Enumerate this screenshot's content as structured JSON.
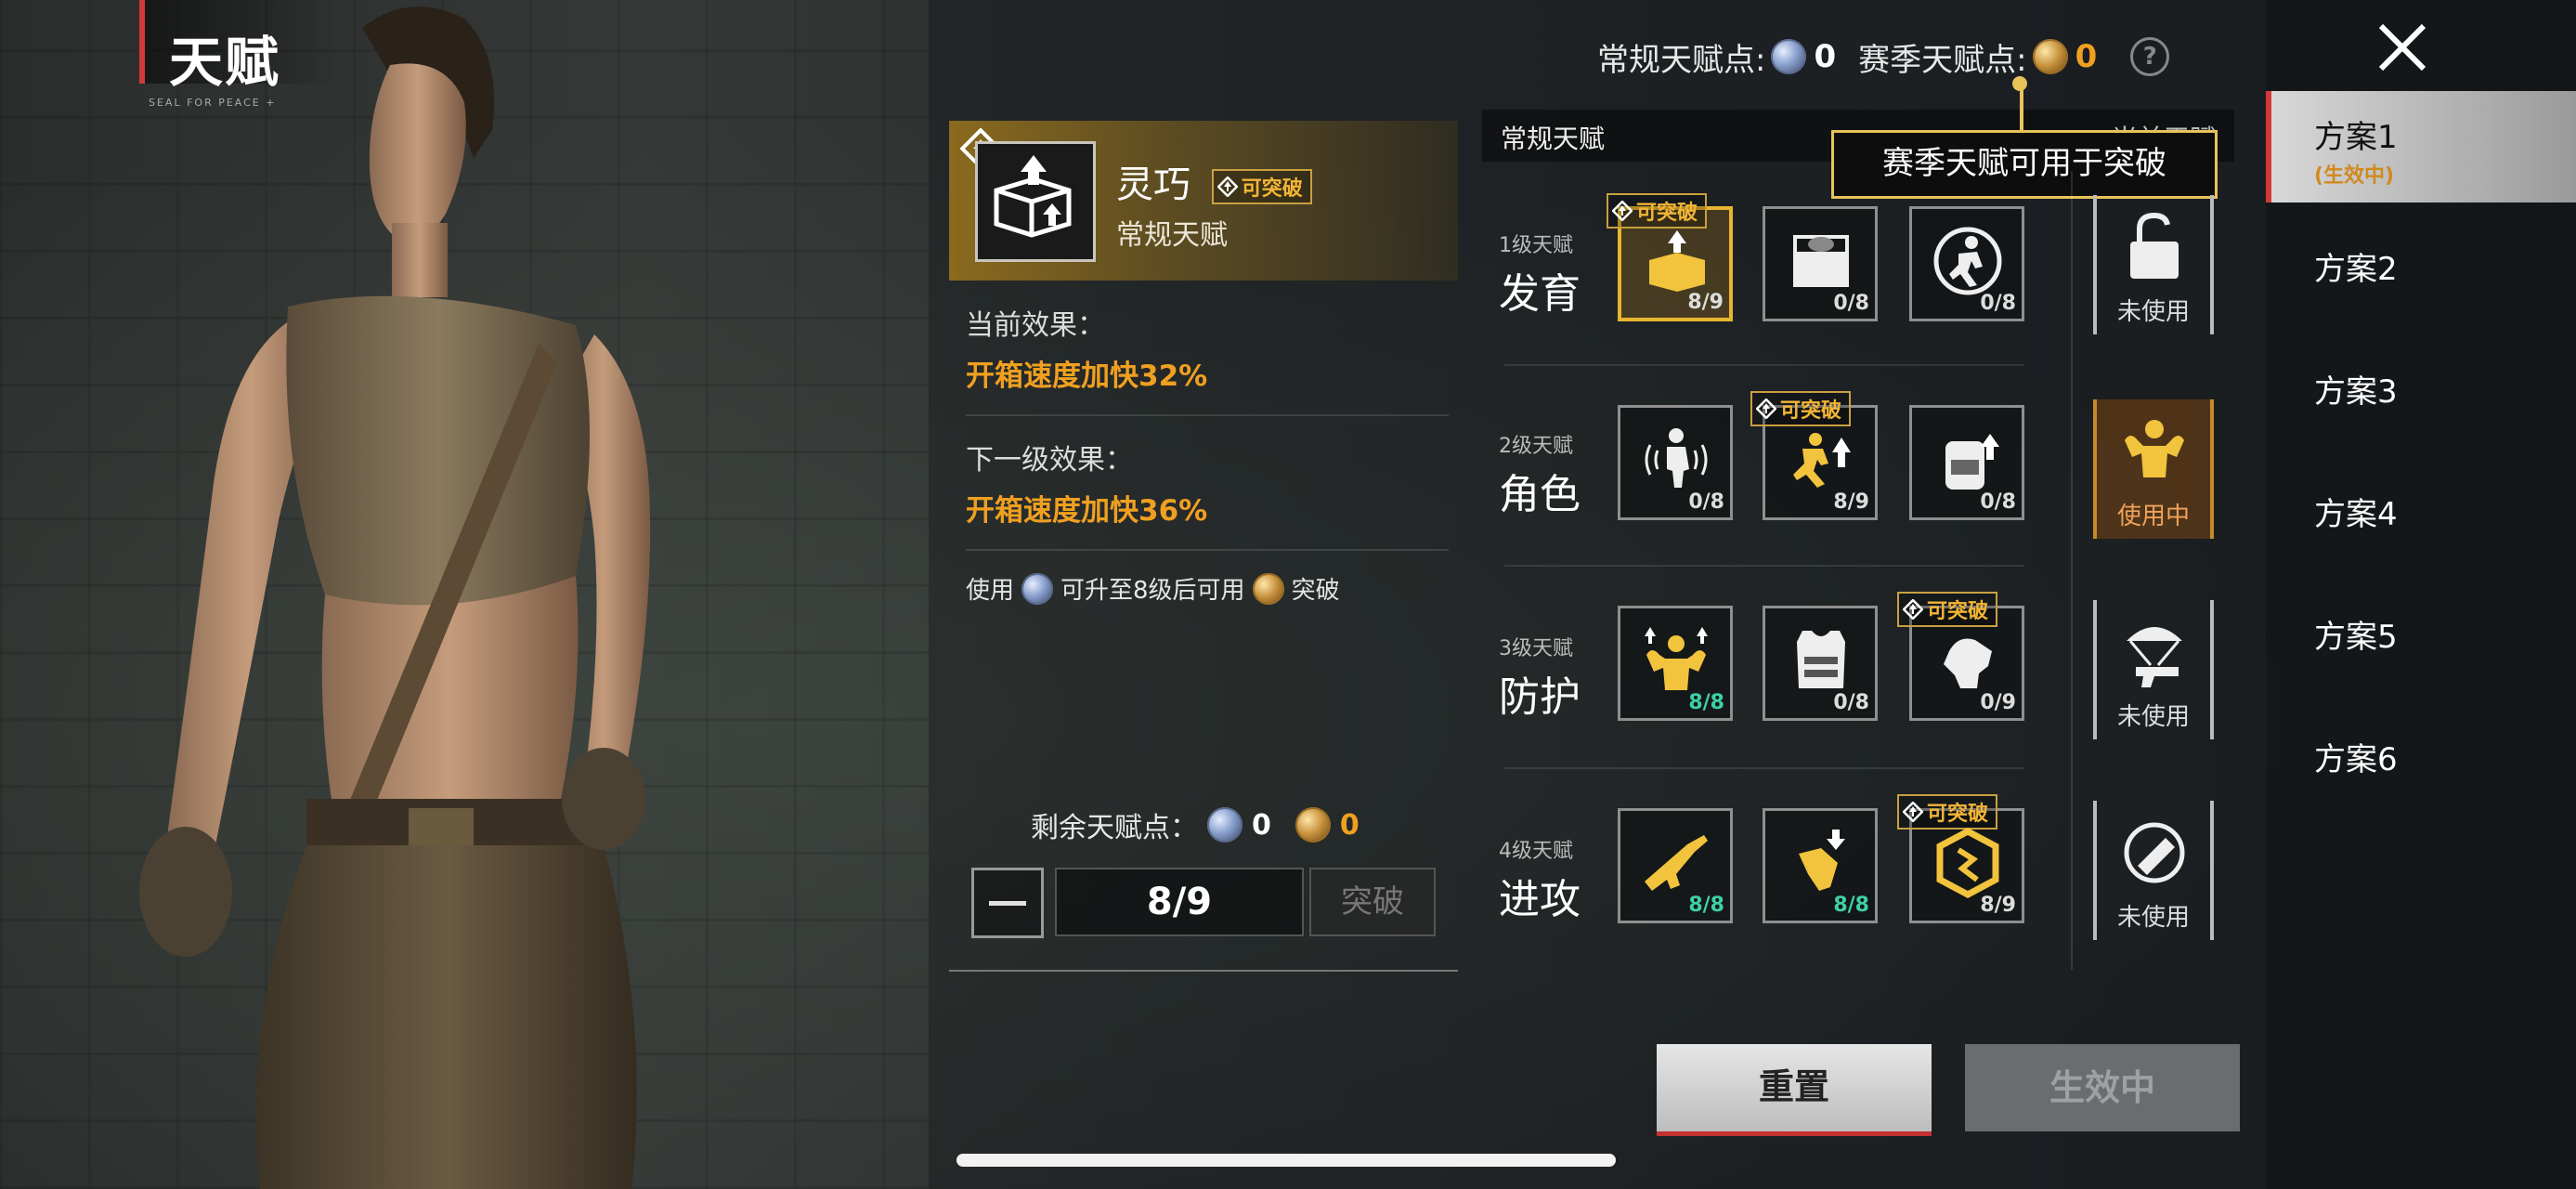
{
  "header": {
    "title": "天赋",
    "subtitle": "SEAL FOR PEACE +"
  },
  "points": {
    "regular_label": "常规天赋点:",
    "regular_value": "0",
    "season_label": "赛季天赋点:",
    "season_value": "0",
    "help_icon": "?"
  },
  "tooltip": {
    "text": "赛季天赋可用于突破"
  },
  "detail": {
    "name": "灵巧",
    "tag": "可突破",
    "type": "常规天赋",
    "current_label": "当前效果：",
    "current_value": "开箱速度加快32%",
    "next_label": "下一级效果：",
    "next_value": "开箱速度加快36%",
    "hint_prefix": "使用",
    "hint_mid": "可升至8级后可用",
    "hint_suffix": "突破",
    "remain_label": "剩余天赋点：",
    "remain_regular": "0",
    "remain_season": "0",
    "level": "8/9",
    "break_button": "突破"
  },
  "grid": {
    "header_left": "常规天赋",
    "header_right": "当前天赋",
    "break_tag": "可突破",
    "tiers": [
      {
        "small": "1级天赋",
        "big": "发育",
        "slots": [
          "8/9",
          "0/8",
          "0/8"
        ],
        "special": "未使用"
      },
      {
        "small": "2级天赋",
        "big": "角色",
        "slots": [
          "0/8",
          "8/9",
          "0/8"
        ],
        "special": "使用中"
      },
      {
        "small": "3级天赋",
        "big": "防护",
        "slots": [
          "8/8",
          "0/8",
          "0/9"
        ],
        "special": "未使用"
      },
      {
        "small": "4级天赋",
        "big": "进攻",
        "slots": [
          "8/8",
          "8/8",
          "8/9"
        ],
        "special": "未使用"
      }
    ]
  },
  "buttons": {
    "reset": "重置",
    "active": "生效中"
  },
  "plans": [
    {
      "name": "方案1",
      "status": "(生效中)"
    },
    {
      "name": "方案2"
    },
    {
      "name": "方案3"
    },
    {
      "name": "方案4"
    },
    {
      "name": "方案5"
    },
    {
      "name": "方案6"
    }
  ]
}
